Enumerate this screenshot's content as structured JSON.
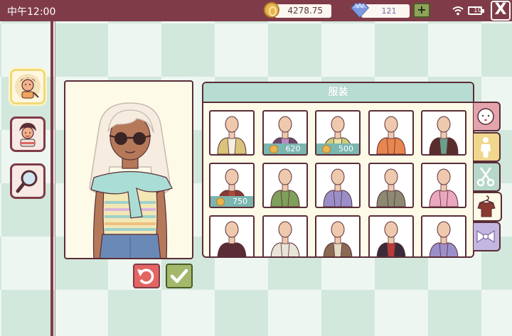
{
  "status_bar": {
    "time": "中午12:00",
    "coins": "4278.75",
    "gems": "121",
    "battery": "10"
  },
  "icons": {
    "coin": "coin-icon",
    "gem": "diamond-icon",
    "plus": "plus-icon",
    "wifi": "wifi-icon",
    "battery": "battery-icon",
    "close": "close-icon"
  },
  "close_label": "X",
  "plus_label": "+",
  "sidebar": {
    "items": [
      {
        "name": "dress-up",
        "icon": "character-avatar-icon",
        "active": true
      },
      {
        "name": "characters",
        "icon": "boy-avatar-icon",
        "active": false
      },
      {
        "name": "search",
        "icon": "magnifier-icon",
        "active": false
      }
    ]
  },
  "panel": {
    "title": "服装"
  },
  "items": [
    {
      "shirt": "#d9c47a",
      "inner": "#f4efe0",
      "price": null
    },
    {
      "shirt": "#6a4a6e",
      "inner": "#b88bc0",
      "price": "620"
    },
    {
      "shirt": "#c9d07a",
      "inner": "#e9e3a3",
      "price": "500"
    },
    {
      "shirt": "#e8864e",
      "inner": "#e8864e",
      "price": null
    },
    {
      "shirt": "#5a2d2d",
      "inner": "#6aa08c",
      "price": null
    },
    {
      "shirt": "#8a3a32",
      "inner": "#a84a3c",
      "price": "750"
    },
    {
      "shirt": "#7ea05a",
      "inner": "#7ea05a",
      "price": null
    },
    {
      "shirt": "#9b8fca",
      "inner": "#9b8fca",
      "price": null
    },
    {
      "shirt": "#8c8a72",
      "inner": "#8c8a72",
      "price": null
    },
    {
      "shirt": "#e9a8c0",
      "inner": "#e9a8c0",
      "price": null
    },
    {
      "shirt": "#5a2d36",
      "inner": "#5a2d36",
      "price": null
    },
    {
      "shirt": "#e8e4d8",
      "inner": "#e8e4d8",
      "price": null
    },
    {
      "shirt": "#8a6a52",
      "inner": "#e3d9c5",
      "price": null
    },
    {
      "shirt": "#3a2a3a",
      "inner": "#b83a3a",
      "price": null
    },
    {
      "shirt": "#9b8fca",
      "inner": "#9b8fca",
      "price": null
    }
  ],
  "tabs": [
    {
      "name": "face",
      "icon": "face-icon",
      "color": "#e4a4ad"
    },
    {
      "name": "body",
      "icon": "body-icon",
      "color": "#f1d68d"
    },
    {
      "name": "hair",
      "icon": "scissors-icon",
      "color": "#b6d7c9"
    },
    {
      "name": "clothing",
      "icon": "hanger-shirt-icon",
      "color": "#fdfbe8",
      "active": true
    },
    {
      "name": "accessories",
      "icon": "bow-icon",
      "color": "#c3b6e0"
    }
  ],
  "actions": {
    "reset": "undo-icon",
    "confirm": "check-icon"
  }
}
